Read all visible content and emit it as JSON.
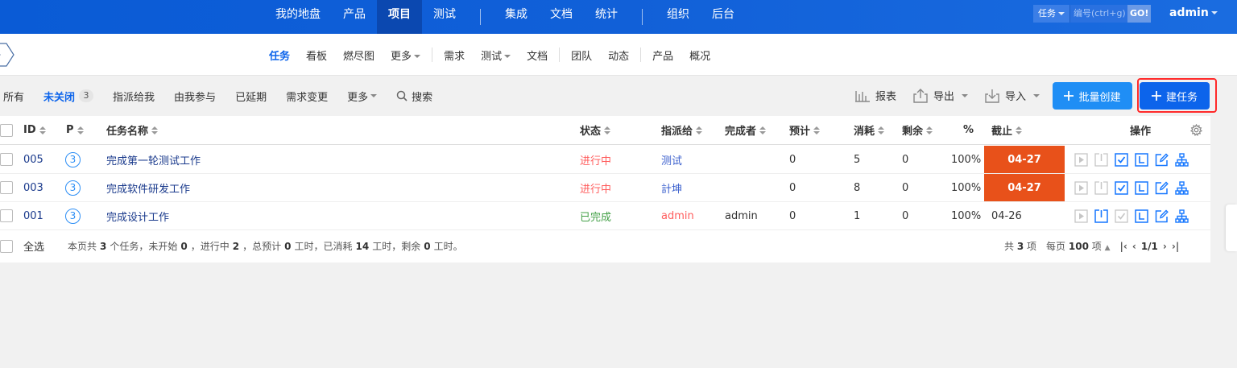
{
  "topnav": {
    "items": [
      "我的地盘",
      "产品",
      "项目",
      "测试",
      "集成",
      "文档",
      "统计",
      "组织",
      "后台"
    ],
    "active": "项目",
    "search_type": "任务",
    "search_placeholder": "编号(ctrl+g)",
    "go_label": "GO!",
    "user": "admin"
  },
  "subnav": {
    "items": [
      "任务",
      "看板",
      "燃尽图",
      "更多",
      "需求",
      "测试",
      "文档",
      "团队",
      "动态",
      "产品",
      "概况"
    ],
    "active": "任务"
  },
  "filters": {
    "items": [
      "所有",
      "未关闭",
      "指派给我",
      "由我参与",
      "已延期",
      "需求变更",
      "更多",
      "搜索"
    ],
    "active": "未关闭",
    "active_count": "3"
  },
  "toolbar": {
    "report": "报表",
    "export": "导出",
    "import": "导入",
    "batch_create": "批量创建",
    "create_task": "建任务"
  },
  "table": {
    "headers": {
      "id": "ID",
      "pri": "P",
      "name": "任务名称",
      "status": "状态",
      "assigned": "指派给",
      "finished_by": "完成者",
      "estimate": "预计",
      "consumed": "消耗",
      "left": "剩余",
      "progress": "%",
      "deadline": "截止",
      "actions": "操作"
    },
    "rows": [
      {
        "id": "005",
        "pri": "3",
        "name": "完成第一轮测试工作",
        "status": "进行中",
        "assigned": "测试",
        "finished_by": "",
        "estimate": "0",
        "consumed": "5",
        "left": "0",
        "progress": "100%",
        "deadline": "04-27"
      },
      {
        "id": "003",
        "pri": "3",
        "name": "完成软件研发工作",
        "status": "进行中",
        "assigned": "計坤",
        "finished_by": "",
        "estimate": "0",
        "consumed": "8",
        "left": "0",
        "progress": "100%",
        "deadline": "04-27"
      },
      {
        "id": "001",
        "pri": "3",
        "name": "完成设计工作",
        "status": "已完成",
        "assigned": "admin",
        "finished_by": "admin",
        "estimate": "0",
        "consumed": "1",
        "left": "0",
        "progress": "100%",
        "deadline": "04-26"
      }
    ]
  },
  "footer": {
    "select_all": "全选",
    "summary_prefix": "本页共",
    "summary_total": "3",
    "summary_mid1": "个任务，未开始",
    "summary_wait": "0",
    "summary_mid2": "，进行中",
    "summary_doing": "2",
    "summary_mid3": "，总预计",
    "summary_estimate": "0",
    "summary_mid4": "工时，已消耗",
    "summary_consumed": "14",
    "summary_mid5": "工时，剩余",
    "summary_left": "0",
    "summary_end": "工时。",
    "total_prefix": "共",
    "total_count": "3",
    "total_suffix": "项",
    "per_page_prefix": "每页",
    "per_page": "100",
    "per_page_suffix": "项",
    "page": "1/1"
  },
  "colors": {
    "topbar": "#0a5bd6",
    "primary": "#0c64eb",
    "batch_button": "#1f8ef5",
    "deadline_overdue": "#e8511a",
    "status_doing": "#ff5d5d",
    "status_done": "#43a047",
    "highlight_box": "#ff2a2a"
  }
}
